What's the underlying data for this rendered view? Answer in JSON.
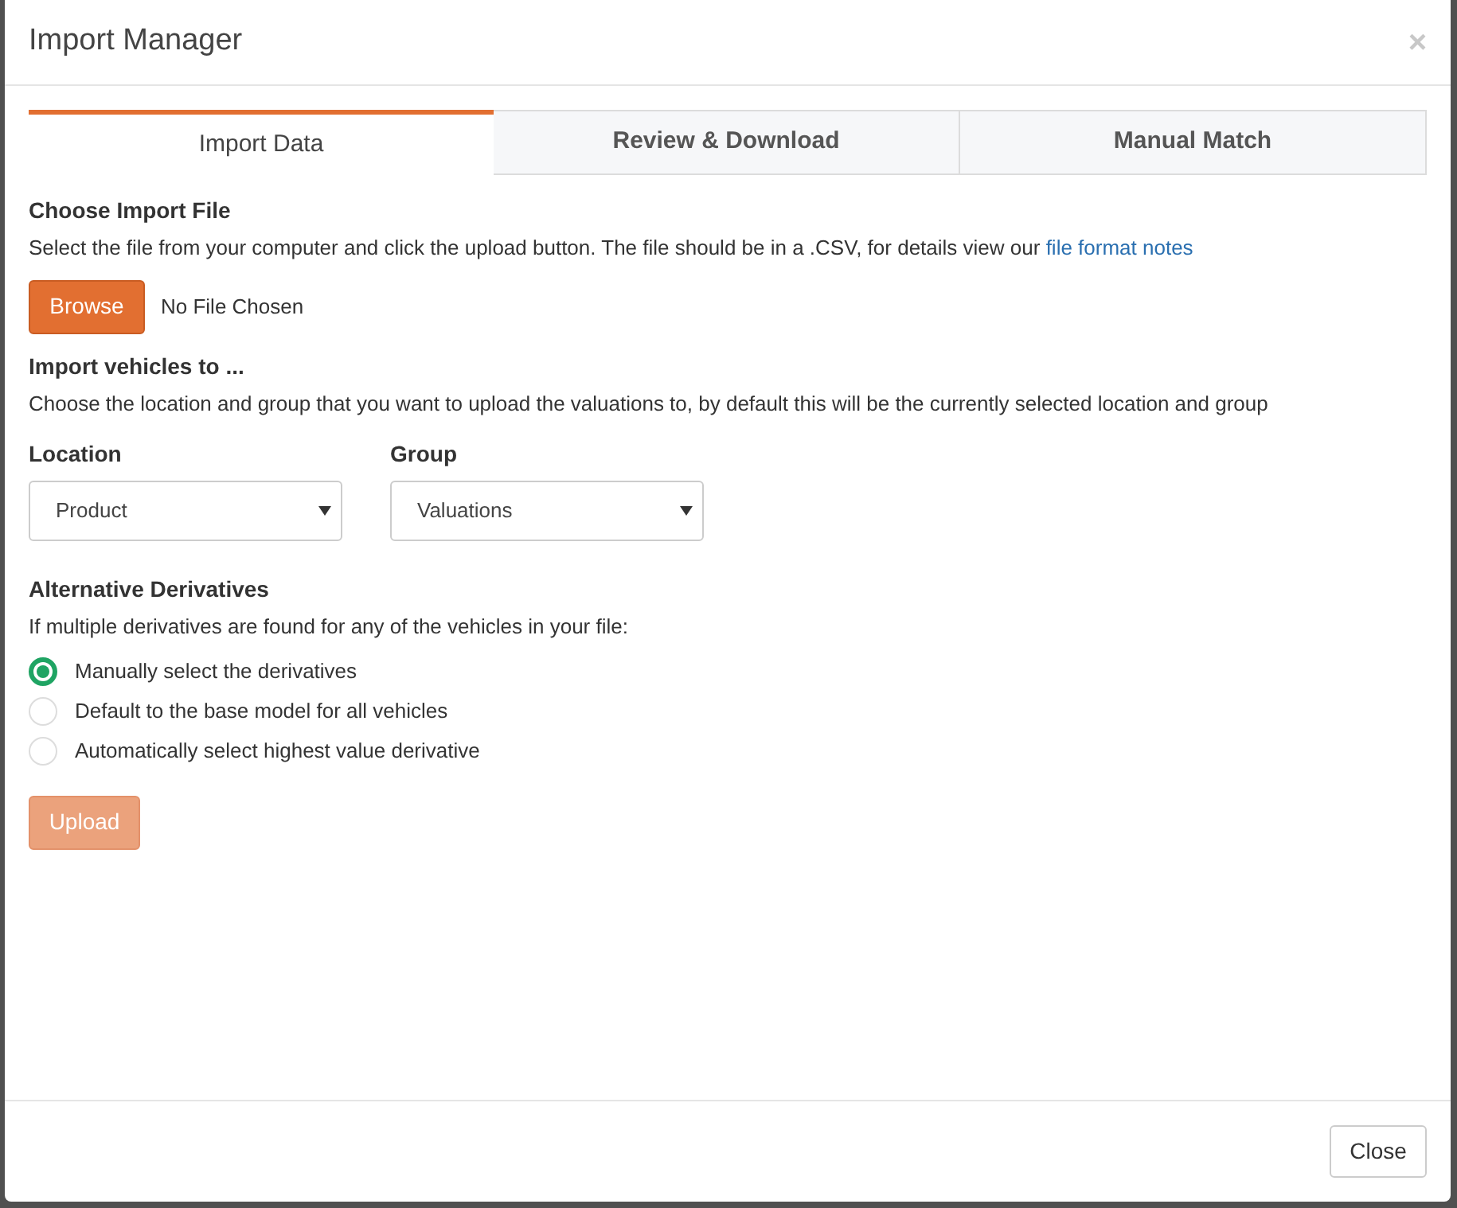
{
  "dialog": {
    "title": "Import Manager",
    "close_glyph": "×"
  },
  "tabs": [
    {
      "label": "Import Data",
      "selected": true
    },
    {
      "label": "Review & Download",
      "selected": false
    },
    {
      "label": "Manual Match",
      "selected": false
    }
  ],
  "choose_file": {
    "heading": "Choose Import File",
    "description": "Select the file from your computer and click the upload button. The file should be in a .CSV, for details view our",
    "link": "file format notes",
    "browse_button": "Browse",
    "file_status": "No File Chosen"
  },
  "import_to": {
    "heading": "Import vehicles to ...",
    "description": "Choose the location and group that you want to upload the valuations to, by default this will be the currently selected location and group",
    "selects": [
      {
        "label": "Location",
        "value": "Product"
      },
      {
        "label": "Group",
        "value": "Valuations"
      }
    ]
  },
  "derivatives": {
    "heading": "Alternative Derivatives",
    "description": "If multiple derivatives are found for any of the vehicles in your file:",
    "options": [
      {
        "label": "Manually select the derivatives",
        "selected": true
      },
      {
        "label": "Default to the base model for all vehicles",
        "selected": false
      },
      {
        "label": "Automatically select highest value derivative",
        "selected": false
      }
    ]
  },
  "upload_button": {
    "label": "Upload",
    "disabled": true
  },
  "footer": {
    "close_button": "Close"
  }
}
